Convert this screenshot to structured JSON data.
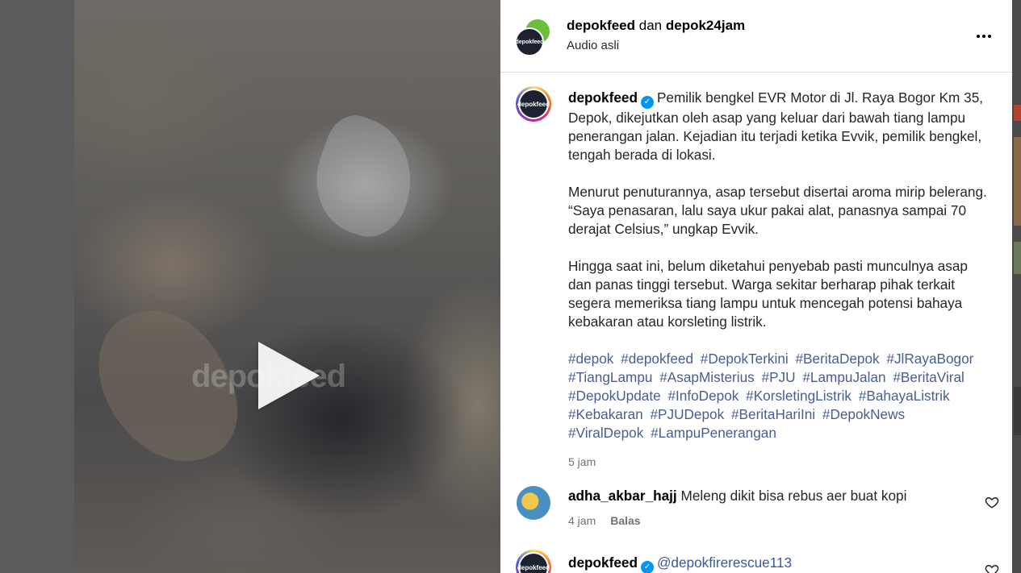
{
  "post": {
    "header": {
      "user1": "depokfeed",
      "joiner": "dan",
      "user2": "depok24jam",
      "audio": "Audio asli",
      "avatar_text": "depokfeed"
    },
    "caption": {
      "username": "depokfeed",
      "paragraph1": "Pemilik bengkel EVR Motor di Jl. Raya Bogor Km 35, Depok, dikejutkan oleh asap yang keluar dari bawah tiang lampu penerangan jalan. Kejadian itu terjadi ketika Evvik, pemilik bengkel, tengah berada di lokasi.",
      "paragraph2": "Menurut penuturannya, asap tersebut disertai aroma mirip belerang. “Saya penasaran, lalu saya ukur pakai alat, panasnya sampai 70 derajat Celsius,” ungkap Evvik.",
      "paragraph3": "Hingga saat ini, belum diketahui penyebab pasti munculnya asap dan panas tinggi tersebut. Warga sekitar berharap pihak terkait segera memeriksa tiang lampu untuk mencegah potensi bahaya kebakaran atau korsleting listrik.",
      "hashtags": [
        "#depok",
        "#depokfeed",
        "#DepokTerkini",
        "#BeritaDepok",
        "#JlRayaBogor",
        "#TiangLampu",
        "#AsapMisterius",
        "#PJU",
        "#LampuJalan",
        "#BeritaViral",
        "#DepokUpdate",
        "#InfoDepok",
        "#KorsletingListrik",
        "#BahayaListrik",
        "#Kebakaran",
        "#PJUDepok",
        "#BeritaHariIni",
        "#DepokNews",
        "#ViralDepok",
        "#LampuPenerangan"
      ],
      "time": "5 jam"
    },
    "comments": [
      {
        "username": "adha_akbar_hajj",
        "text": "Meleng dikit bisa rebus aer buat kopi",
        "time": "4 jam",
        "reply_label": "Balas"
      },
      {
        "username": "depokfeed",
        "mention": "@depokfirerescue113"
      }
    ]
  },
  "video": {
    "watermark": "depokfeed"
  },
  "colors": {
    "verified": "#0095f6",
    "hashtag": "#4a5d92",
    "muted": "#737373"
  },
  "icons": [
    "play-icon",
    "more-icon",
    "verified-icon",
    "heart-icon"
  ]
}
